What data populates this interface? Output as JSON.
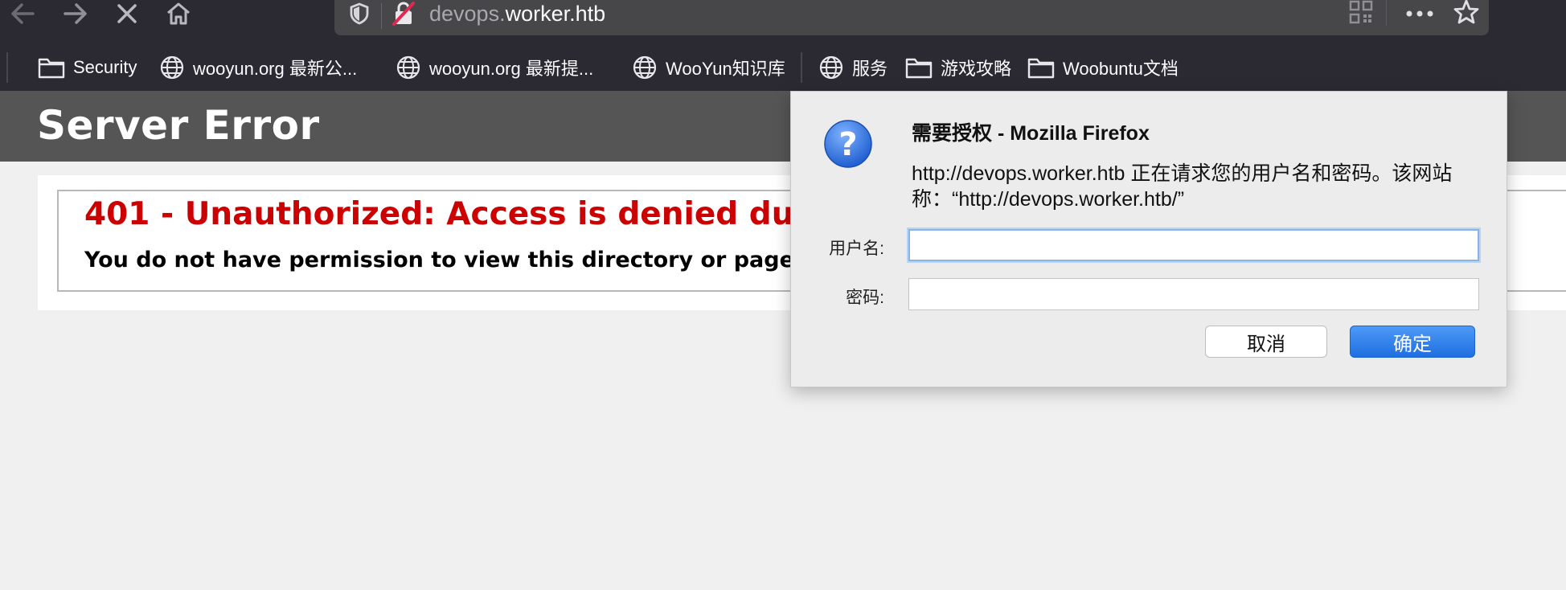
{
  "browser": {
    "url_host_prefix": "devops.",
    "url_host_main": "worker.htb",
    "bookmarks": [
      {
        "label": "Security",
        "icon": "folder-icon"
      },
      {
        "label": "wooyun.org 最新公...",
        "icon": "globe-icon"
      },
      {
        "label": "wooyun.org 最新提...",
        "icon": "globe-icon"
      },
      {
        "label": "WooYun知识库",
        "icon": "globe-icon"
      },
      {
        "label": "服务",
        "icon": "globe-icon"
      },
      {
        "label": "游戏攻略",
        "icon": "folder-icon"
      },
      {
        "label": "Woobuntu文档",
        "icon": "folder-icon"
      }
    ]
  },
  "page": {
    "title": "Server Error",
    "error_heading": "401 - Unauthorized: Access is denied due",
    "error_message": "You do not have permission to view this directory or page"
  },
  "dialog": {
    "title": "需要授权 - Mozilla Firefox",
    "message": "http://devops.worker.htb 正在请求您的用户名和密码。该网站称：“http://devops.worker.htb/”",
    "username_label": "用户名:",
    "password_label": "密码:",
    "username_value": "",
    "password_value": "",
    "cancel_label": "取消",
    "ok_label": "确定"
  },
  "colors": {
    "toolbar_bg": "#2b2a33",
    "page_header_bg": "#555555",
    "error_red": "#cc0000",
    "ok_button_blue": "#1f6fe0",
    "help_icon_blue": "#1f5fd0"
  }
}
